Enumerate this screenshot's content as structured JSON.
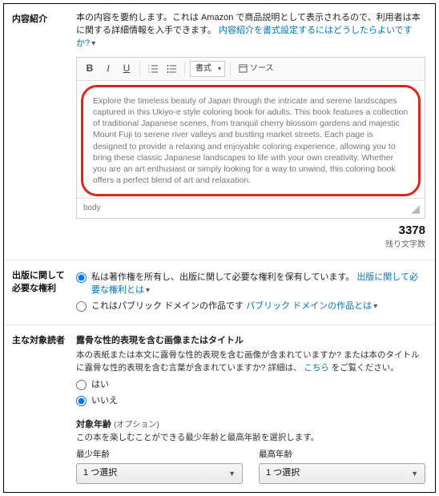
{
  "desc": {
    "heading": "内容紹介",
    "intro_pre": "本の内容を要約します。これは Amazon で商品説明として表示されるので、利用者は本に関する詳細情報を入手できます。",
    "intro_link": "内容紹介を書式設定するにはどうしたらよいですか?",
    "toolbar": {
      "bold": "B",
      "italic": "I",
      "underline": "U",
      "format_label": "書式",
      "source_label": "ソース"
    },
    "editor_text": "Explore the timeless beauty of Japan through the intricate and serene landscapes captured in this Ukiyo-e style coloring book for adults. This book features a collection of traditional Japanese scenes, from tranquil cherry blossom gardens and majestic Mount Fuji to serene river valleys and bustling market streets. Each page is designed to provide a relaxing and enjoyable coloring experience, allowing you to bring these classic Japanese landscapes to life with your own creativity. Whether you are an art enthusiast or simply looking for a way to unwind, this coloring book offers a perfect blend of art and relaxation.",
    "footer_path": "body",
    "remaining_num": "3378",
    "remaining_label": "残り文字数"
  },
  "rights": {
    "heading": "出版に関して必要な権利",
    "opt1_text": "私は著作権を所有し、出版に関して必要な権利を保有しています。",
    "opt1_link": "出版に関して必要な権利とは",
    "opt2_text": "これはパブリック ドメインの作品です",
    "opt2_link": "パブリック ドメインの作品とは"
  },
  "audience": {
    "heading": "主な対象読者",
    "explicit_title": "露骨な性的表現を含む画像またはタイトル",
    "explicit_desc_pre": "本の表紙または本文に露骨な性的表現を含む画像が含まれていますか? または本のタイトルに露骨な性的表現を含む言葉が含まれていますか? 詳細は、",
    "explicit_link": "こちら",
    "explicit_desc_post": "をご覧ください。",
    "opt_yes": "はい",
    "opt_no": "いいえ",
    "age_title": "対象年齢",
    "age_optional": "(オプション)",
    "age_helper": "この本を楽しむことができる最少年齢と最高年齢を選択します。",
    "min_label": "最少年齢",
    "max_label": "最高年齢",
    "select_placeholder": "1 つ選択"
  }
}
